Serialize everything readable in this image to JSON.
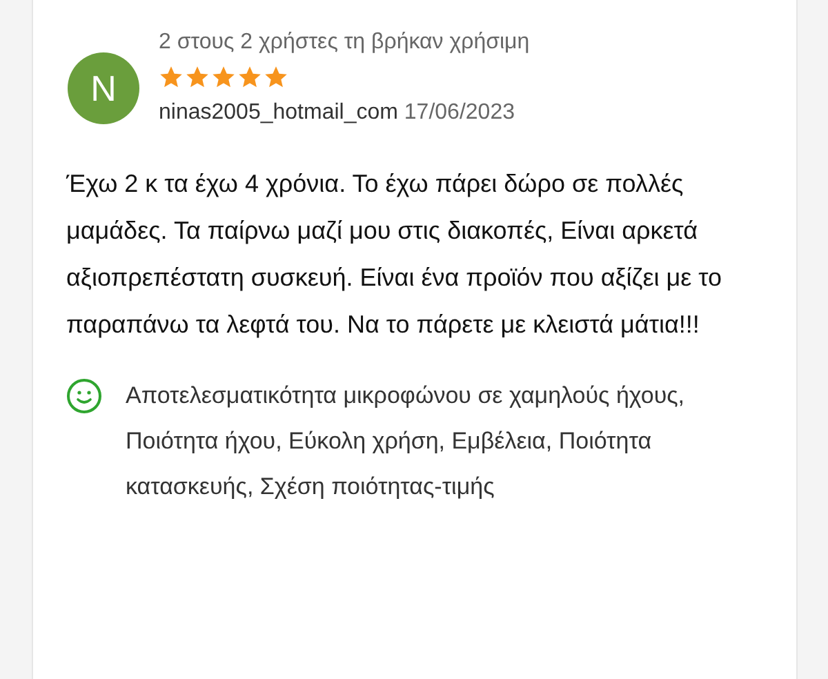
{
  "review": {
    "helpful": "2 στους 2 χρήστες τη βρήκαν χρήσιμη",
    "avatar_letter": "N",
    "stars": 5,
    "author": "ninas2005_hotmail_com",
    "date": "17/06/2023",
    "body": "Έχω 2 κ τα έχω 4 χρόνια. Το έχω πάρει δώρο σε πολλές μαμάδες. Τα παίρνω μαζί μου στις διακοπές, Είναι αρκετά αξιοπρεπέστατη συσκευή. Είναι ένα προϊόν που αξίζει με το παραπάνω τα λεφτά του. Να το πάρετε με κλειστά μάτια!!!",
    "pros": [
      "Αποτελεσματικότητα μικροφώνου σε χαμηλούς ήχους,",
      "Ποιότητα ήχου, Εύκολη χρήση, Εμβέλεια, Ποιότητα κατασκευής, Σχέση ποιότητας-τιμής"
    ]
  }
}
